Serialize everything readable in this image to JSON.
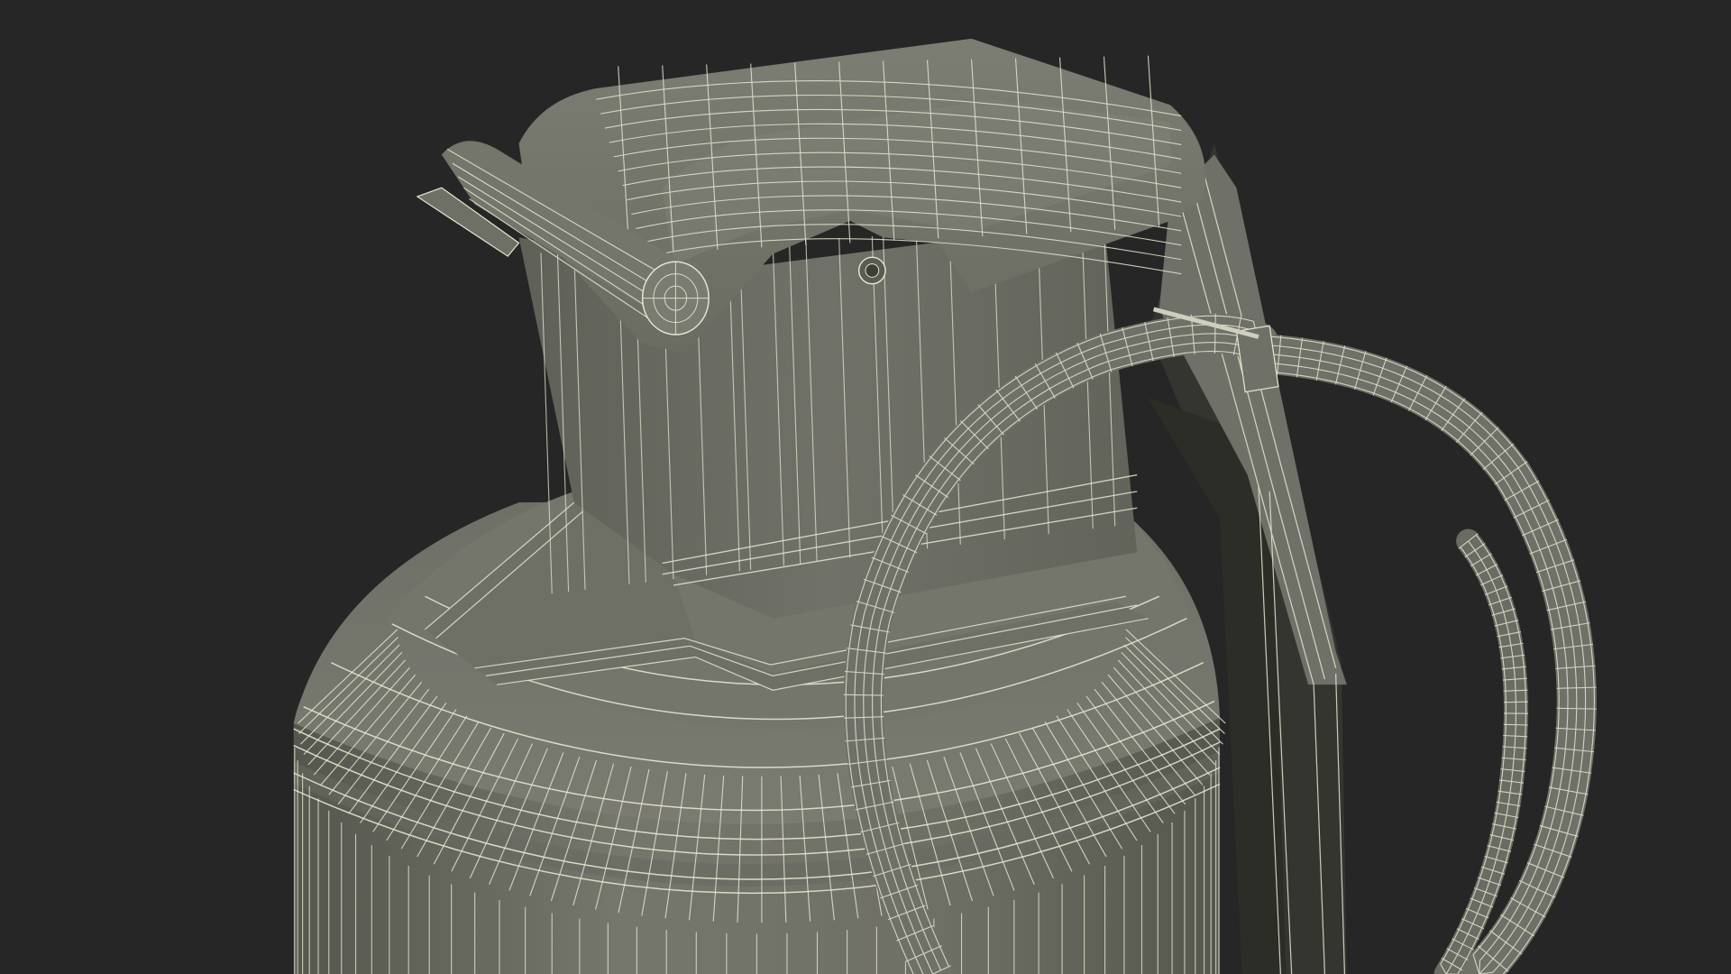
{
  "scene": {
    "subject": "wireframe-render",
    "background_color": "#262626",
    "body_color": "#6d6e64",
    "body_shadow_color": "#3a3b33",
    "wire_color": "#e6e6d2",
    "has_visible_text": false
  }
}
